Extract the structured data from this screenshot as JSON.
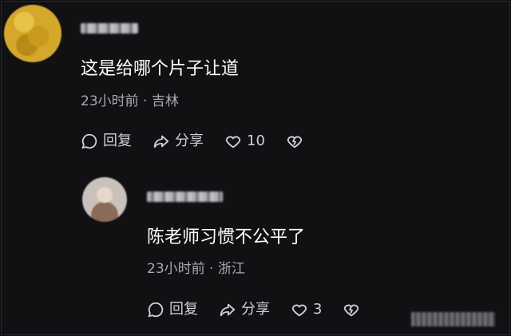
{
  "comment": {
    "text": "这是给哪个片子让道",
    "meta": "23小时前 · 吉林",
    "actions": {
      "reply_label": "回复",
      "share_label": "分享",
      "like_count": "10"
    }
  },
  "reply": {
    "text": "陈老师习惯不公平了",
    "meta": "23小时前 · 浙江",
    "actions": {
      "reply_label": "回复",
      "share_label": "分享",
      "like_count": "3"
    }
  },
  "icons": {
    "reply": "speech-bubble-icon",
    "share": "share-arrow-icon",
    "like": "heart-outline-icon",
    "dislike": "broken-heart-icon"
  },
  "colors": {
    "background": "#111114",
    "text": "#ffffff",
    "meta": "#a9a9b2",
    "icon": "#cfcfd6"
  }
}
